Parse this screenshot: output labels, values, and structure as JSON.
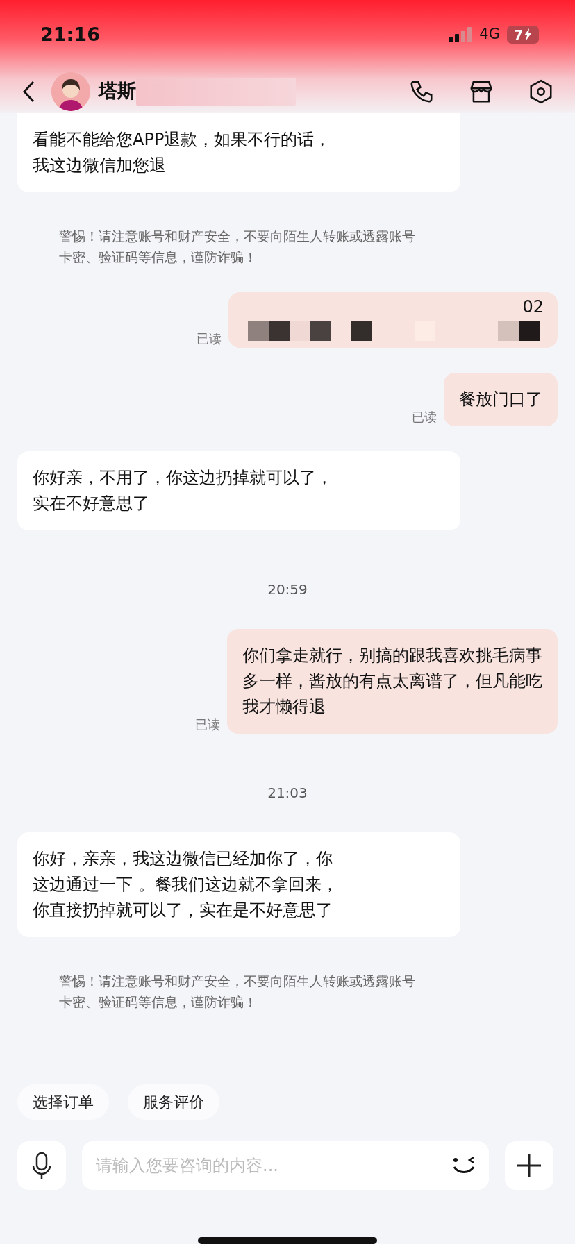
{
  "status_bar": {
    "time": "21:16",
    "network": "4G",
    "battery": "7",
    "charging": true
  },
  "header": {
    "title": "塔斯",
    "title_redacted": true
  },
  "messages": [
    {
      "kind": "incoming",
      "lines": [
        "看能不能给您APP退款，如果不行的话，",
        "我这边微信加您退"
      ],
      "cut_top": true
    },
    {
      "kind": "notice",
      "lines": [
        "警惕！请注意账号和财产安全，不要向陌生人转账或透露账号",
        "卡密、验证码等信息，谨防诈骗！"
      ]
    },
    {
      "kind": "outgoing",
      "redacted": true,
      "lines": [
        "02"
      ],
      "read_label": "已读"
    },
    {
      "kind": "outgoing",
      "lines": [
        "餐放门口了"
      ],
      "read_label": "已读"
    },
    {
      "kind": "incoming",
      "lines": [
        "你好亲，不用了，你这边扔掉就可以了，",
        "实在不好意思了"
      ]
    },
    {
      "kind": "time",
      "lines": [
        "20:59"
      ]
    },
    {
      "kind": "outgoing",
      "lines": [
        "你们拿走就行，别搞的跟我喜欢挑毛病事",
        "多一样，酱放的有点太离谱了，但凡能吃",
        "我才懒得退"
      ],
      "read_label": "已读"
    },
    {
      "kind": "time",
      "lines": [
        "21:03"
      ]
    },
    {
      "kind": "incoming",
      "lines": [
        "你好，亲亲，我这边微信已经加你了，你",
        "这边通过一下 。餐我们这边就不拿回来，",
        "你直接扔掉就可以了，实在是不好意思了"
      ]
    },
    {
      "kind": "notice",
      "lines": [
        "警惕！请注意账号和财产安全，不要向陌生人转账或透露账号",
        "卡密、验证码等信息，谨防诈骗！"
      ]
    }
  ],
  "quick_actions": [
    "选择订单",
    "服务评价"
  ],
  "composer": {
    "placeholder": "请输入您要咨询的内容..."
  }
}
